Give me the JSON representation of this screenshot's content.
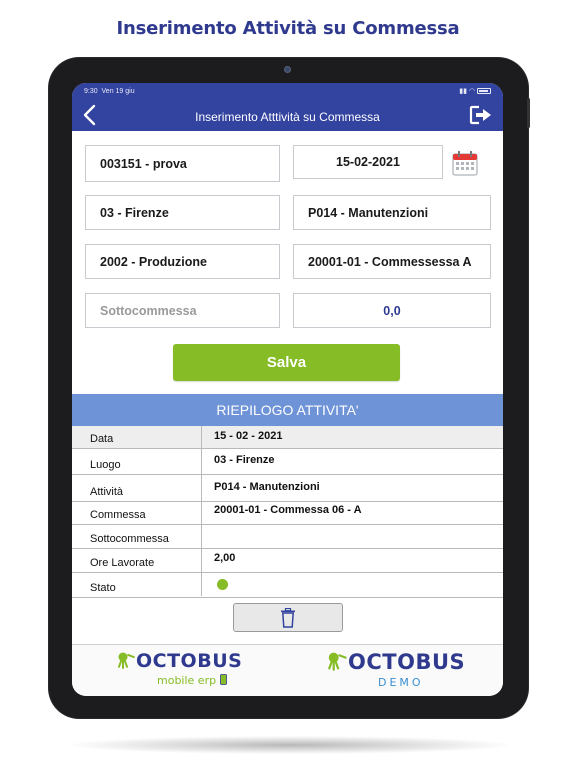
{
  "page": {
    "heading": "Inserimento Attività su Commessa"
  },
  "status_bar": {
    "time": "9:30",
    "date": "Ven 19 giu"
  },
  "header": {
    "title": "Inserimento Atttività su Commessa"
  },
  "form": {
    "cliente": "003151 - prova",
    "data": "15-02-2021",
    "luogo": "03 - Firenze",
    "attivita": "P014 - Manutenzioni",
    "commessa": "2002 - Produzione",
    "commessa_fase": "20001-01 - Commessessa A",
    "sottocommessa_placeholder": "Sottocommessa",
    "ore": "0,0"
  },
  "actions": {
    "save_label": "Salva"
  },
  "summary": {
    "title": "RIEPILOGO ATTIVITA'",
    "rows": [
      {
        "label": "Data",
        "value": "15 - 02 - 2021"
      },
      {
        "label": "Luogo",
        "value": "03 - Firenze"
      },
      {
        "label": "Attività",
        "value": "P014 - Manutenzioni"
      },
      {
        "label": "Commessa",
        "value": "20001-01 - Commessa 06 - A"
      },
      {
        "label": "Sottocommessa",
        "value": ""
      },
      {
        "label": "Ore Lavorate",
        "value": "2,00"
      },
      {
        "label": "Stato",
        "value": ""
      }
    ],
    "status_color": "#86bc25"
  },
  "footer": {
    "logo1": {
      "word": "OCTOBUS",
      "sub": "mobile erp"
    },
    "logo2": {
      "word": "OCTOBUS",
      "sub": "DEMO"
    }
  },
  "colors": {
    "brand_blue": "#3243a0",
    "accent_green": "#86bc25",
    "summary_blue": "#6e93d6"
  }
}
